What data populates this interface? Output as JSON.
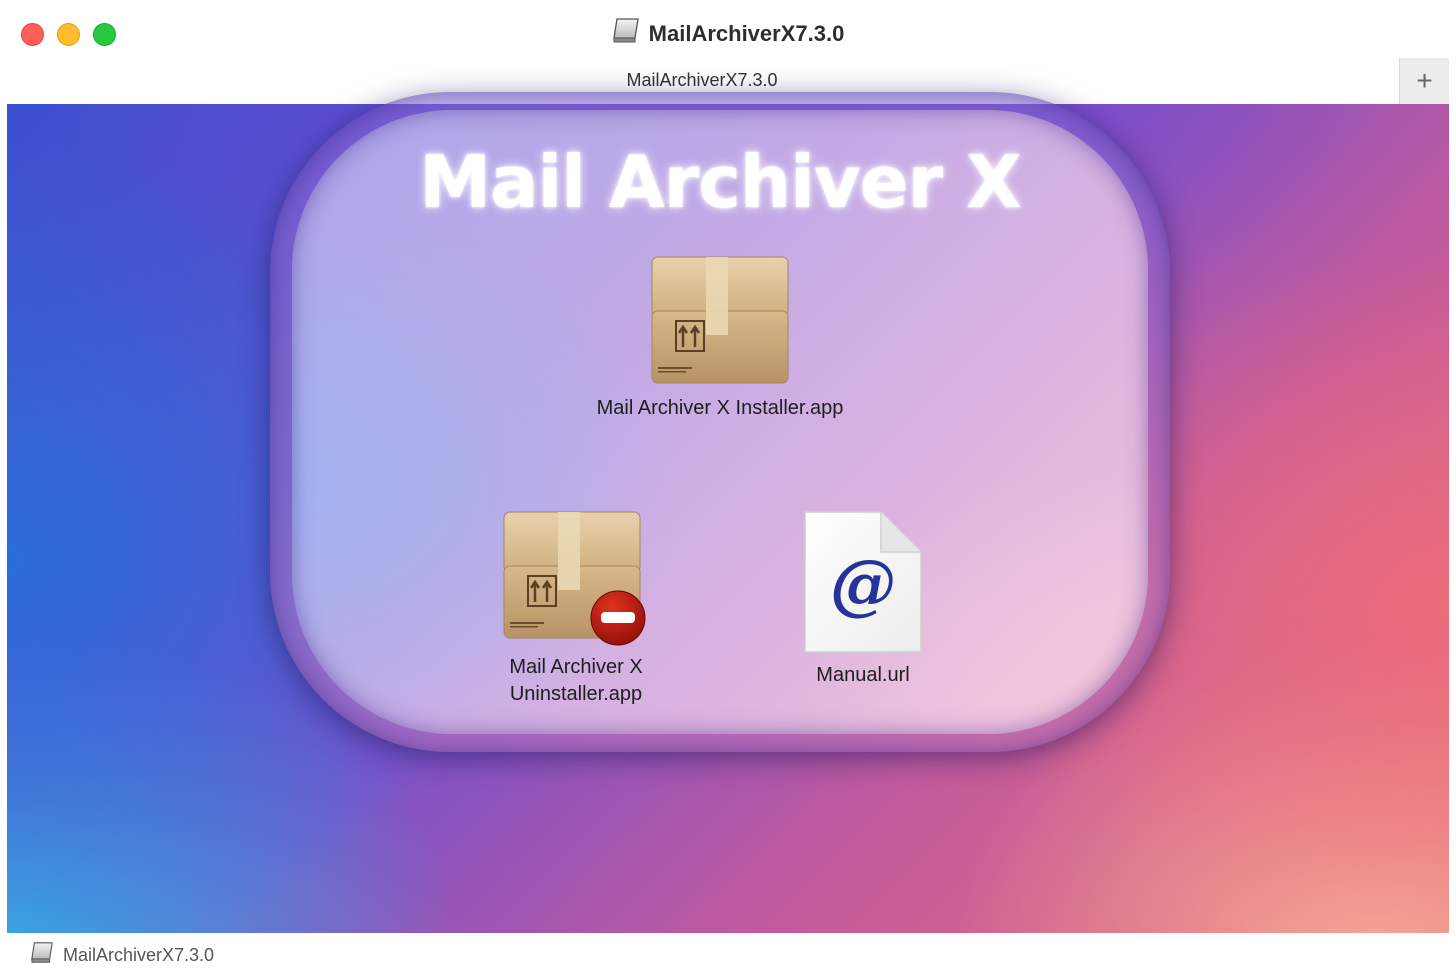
{
  "window": {
    "title": "MailArchiverX7.3.0",
    "title_icon": "disk-image-icon"
  },
  "tab": {
    "label": "MailArchiverX7.3.0",
    "add_label": "+"
  },
  "content": {
    "brand": "Mail Archiver X",
    "items": [
      {
        "label": "Mail Archiver X Installer.app",
        "icon": "package-icon"
      },
      {
        "label_line1": "Mail Archiver X",
        "label_line2": "Uninstaller.app",
        "icon": "package-remove-icon"
      },
      {
        "label": "Manual.url",
        "icon": "url-document-icon"
      }
    ]
  },
  "statusbar": {
    "path": "MailArchiverX7.3.0",
    "icon": "disk-image-icon"
  },
  "colors": {
    "close": "#ff5f57",
    "minimize": "#febc2e",
    "maximize": "#28c840"
  }
}
